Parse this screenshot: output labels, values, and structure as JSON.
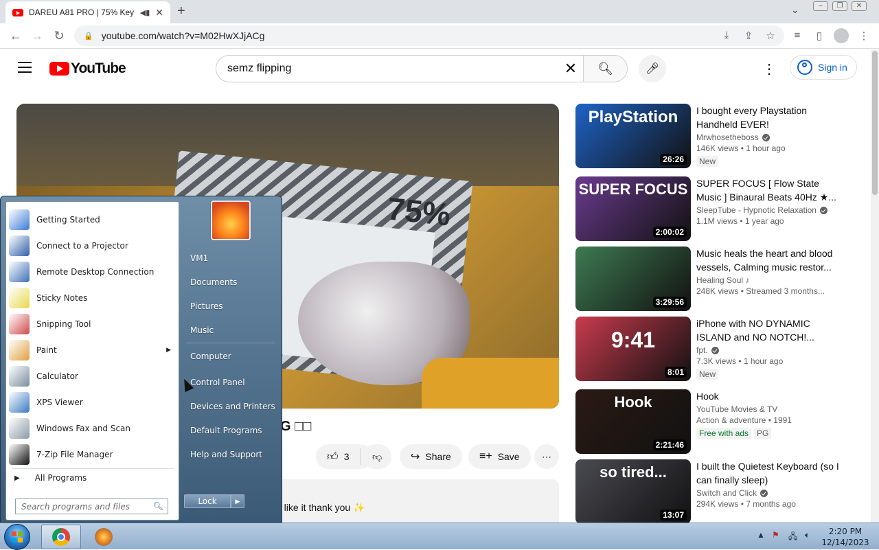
{
  "browser": {
    "tab_title": "DAREU A81 PRO | 75% Keyb",
    "url": "youtube.com/watch?v=M02HwXJjACg",
    "new_tab_label": "+",
    "tab_close": "✕",
    "icons": [
      "back-icon",
      "forward-icon",
      "reload-icon",
      "lock-icon",
      "install-icon",
      "share-icon",
      "star-icon",
      "media-icon",
      "sidepanel-icon",
      "profile-icon",
      "menu-icon"
    ]
  },
  "youtube": {
    "logo_text": "YouTube",
    "search_value": "semz flipping",
    "sign_in_label": "Sign in",
    "video_title_partial": "G □□",
    "like_count": "3",
    "share_label": "Share",
    "save_label": "Save",
    "description_partial": "u like it thank you ✨",
    "recommendations": [
      {
        "title": "I bought every Playstation Handheld EVER!",
        "channel": "Mrwhosetheboss",
        "verified": true,
        "stats": "146K views • 1 hour ago",
        "badge": "New",
        "duration": "26:26",
        "thumb_text": "PlayStation",
        "thumb_color": "#1f63c6"
      },
      {
        "title": "SUPER FOCUS [ Flow State Music ] Binaural Beats 40Hz ★...",
        "channel": "SleepTube - Hypnotic Relaxation",
        "verified": true,
        "stats": "1.1M views • 1 year ago",
        "badge": "",
        "duration": "2:00:02",
        "thumb_text": "SUPER FOCUS",
        "thumb_color": "#6a3b8e"
      },
      {
        "title": "Music heals the heart and blood vessels, Calming music restor...",
        "channel": "Healing Soul ♪",
        "verified": false,
        "stats": "248K views • Streamed 3 months...",
        "badge": "",
        "duration": "3:29:56",
        "thumb_text": "",
        "thumb_color": "#3f7a52"
      },
      {
        "title": "iPhone with NO DYNAMIC ISLAND and NO NOTCH!...",
        "channel": "fpt.",
        "verified": true,
        "stats": "7.3K views • 1 hour ago",
        "badge": "New",
        "duration": "8:01",
        "thumb_text": "9:41",
        "thumb_color": "#c93b4e"
      },
      {
        "title": "Hook",
        "channel": "YouTube Movies & TV",
        "verified": false,
        "stats": "Action & adventure • 1991",
        "badge": "Free with ads",
        "badge2": "PG",
        "duration": "2:21:46",
        "thumb_text": "Hook",
        "thumb_color": "#2a1a14"
      },
      {
        "title": "I built the Quietest Keyboard (so I can finally sleep)",
        "channel": "Switch and Click",
        "verified": true,
        "stats": "294K views • 7 months ago",
        "badge": "",
        "duration": "13:07",
        "thumb_text": "so tired...",
        "thumb_color": "#4a4a52"
      }
    ]
  },
  "start_menu": {
    "programs": [
      {
        "label": "Getting Started",
        "icon": "getting-started-icon",
        "color": "#3b7bd8"
      },
      {
        "label": "Connect to a Projector",
        "icon": "projector-icon",
        "color": "#2f5fa8"
      },
      {
        "label": "Remote Desktop Connection",
        "icon": "remote-desktop-icon",
        "color": "#3d6fb8"
      },
      {
        "label": "Sticky Notes",
        "icon": "sticky-notes-icon",
        "color": "#e8d84a"
      },
      {
        "label": "Snipping Tool",
        "icon": "snipping-tool-icon",
        "color": "#d04848"
      },
      {
        "label": "Paint",
        "icon": "paint-icon",
        "color": "#e0a040",
        "submenu": true
      },
      {
        "label": "Calculator",
        "icon": "calculator-icon",
        "color": "#7b8c9e"
      },
      {
        "label": "XPS Viewer",
        "icon": "xps-viewer-icon",
        "color": "#3a7ac2"
      },
      {
        "label": "Windows Fax and Scan",
        "icon": "fax-scan-icon",
        "color": "#8a9aa8"
      },
      {
        "label": "7-Zip File Manager",
        "icon": "7zip-icon",
        "color": "#111111"
      }
    ],
    "all_programs": "All Programs",
    "search_placeholder": "Search programs and files",
    "right_items": [
      "VM1",
      "Documents",
      "Pictures",
      "Music",
      "Computer",
      "Control Panel",
      "Devices and Printers",
      "Default Programs",
      "Help and Support"
    ],
    "lock_label": "Lock"
  },
  "taskbar": {
    "time": "2:20 PM",
    "date": "12/14/2023"
  }
}
